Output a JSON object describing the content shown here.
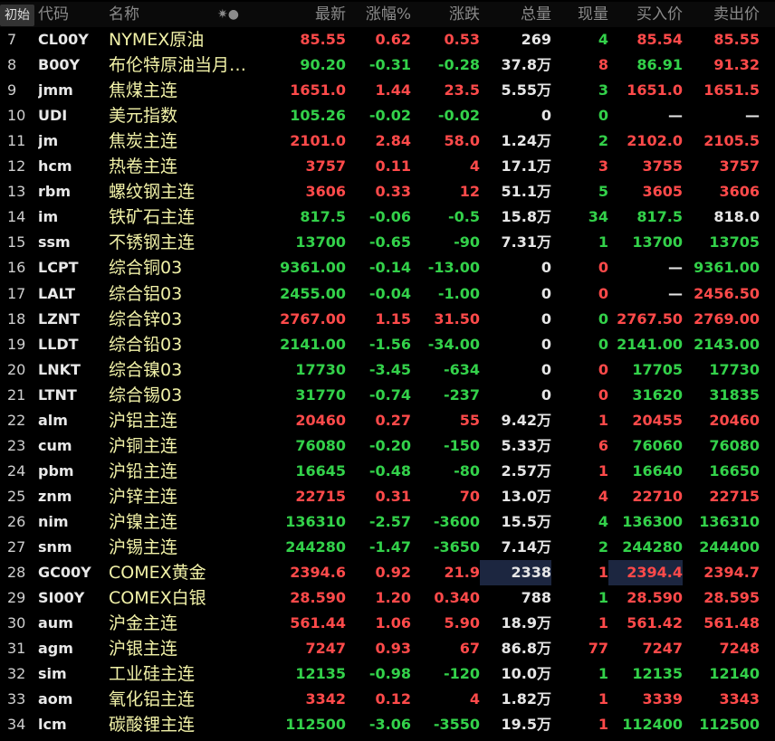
{
  "header": {
    "init": "初始",
    "code": "代码",
    "name": "名称",
    "icons": "✷●",
    "last": "最新",
    "pct": "涨幅%",
    "chg": "涨跌",
    "vol": "总量",
    "cur": "现量",
    "bid": "买入价",
    "ask": "卖出价"
  },
  "colors": {
    "up": "#ff4a4a",
    "down": "#33d14a",
    "name": "#f2f2a8",
    "highlight": "#1c2640"
  },
  "rows": [
    {
      "no": "7",
      "code": "CL00Y",
      "name": "NYMEX原油",
      "last": "85.55",
      "pct": "0.62",
      "chg": "0.53",
      "vol": "269",
      "cur": "4",
      "bid": "85.54",
      "ask": "85.55",
      "d": "up",
      "cd": "dn",
      "bd": "up",
      "ad": "up"
    },
    {
      "no": "8",
      "code": "B00Y",
      "name": "布伦特原油当月…",
      "last": "90.20",
      "pct": "-0.31",
      "chg": "-0.28",
      "vol": "37.8万",
      "cur": "8",
      "bid": "86.91",
      "ask": "91.32",
      "d": "dn",
      "cd": "up",
      "bd": "dn",
      "ad": "up"
    },
    {
      "no": "9",
      "code": "jmm",
      "name": "焦煤主连",
      "last": "1651.0",
      "pct": "1.44",
      "chg": "23.5",
      "vol": "5.55万",
      "cur": "3",
      "bid": "1651.0",
      "ask": "1651.5",
      "d": "up",
      "cd": "dn",
      "bd": "up",
      "ad": "up"
    },
    {
      "no": "10",
      "code": "UDI",
      "name": "美元指数",
      "last": "105.26",
      "pct": "-0.02",
      "chg": "-0.02",
      "vol": "0",
      "cur": "0",
      "bid": "—",
      "ask": "—",
      "d": "dn",
      "cd": "dn",
      "bd": "flat",
      "ad": "flat"
    },
    {
      "no": "11",
      "code": "jm",
      "name": "焦炭主连",
      "last": "2101.0",
      "pct": "2.84",
      "chg": "58.0",
      "vol": "1.24万",
      "cur": "2",
      "bid": "2102.0",
      "ask": "2105.5",
      "d": "up",
      "cd": "dn",
      "bd": "up",
      "ad": "up"
    },
    {
      "no": "12",
      "code": "hcm",
      "name": "热卷主连",
      "last": "3757",
      "pct": "0.11",
      "chg": "4",
      "vol": "17.1万",
      "cur": "3",
      "bid": "3755",
      "ask": "3757",
      "d": "up",
      "cd": "up",
      "bd": "up",
      "ad": "up"
    },
    {
      "no": "13",
      "code": "rbm",
      "name": "螺纹钢主连",
      "last": "3606",
      "pct": "0.33",
      "chg": "12",
      "vol": "51.1万",
      "cur": "5",
      "bid": "3605",
      "ask": "3606",
      "d": "up",
      "cd": "dn",
      "bd": "up",
      "ad": "up"
    },
    {
      "no": "14",
      "code": "im",
      "name": "铁矿石主连",
      "last": "817.5",
      "pct": "-0.06",
      "chg": "-0.5",
      "vol": "15.8万",
      "cur": "34",
      "bid": "817.5",
      "ask": "818.0",
      "d": "dn",
      "cd": "dn",
      "bd": "dn",
      "ad": "flat"
    },
    {
      "no": "15",
      "code": "ssm",
      "name": "不锈钢主连",
      "last": "13700",
      "pct": "-0.65",
      "chg": "-90",
      "vol": "7.31万",
      "cur": "1",
      "bid": "13700",
      "ask": "13705",
      "d": "dn",
      "cd": "dn",
      "bd": "dn",
      "ad": "dn"
    },
    {
      "no": "16",
      "code": "LCPT",
      "name": "综合铜03",
      "last": "9361.00",
      "pct": "-0.14",
      "chg": "-13.00",
      "vol": "0",
      "cur": "0",
      "bid": "—",
      "ask": "9361.00",
      "d": "dn",
      "cd": "up",
      "bd": "flat",
      "ad": "dn"
    },
    {
      "no": "17",
      "code": "LALT",
      "name": "综合铝03",
      "last": "2455.00",
      "pct": "-0.04",
      "chg": "-1.00",
      "vol": "0",
      "cur": "0",
      "bid": "—",
      "ask": "2456.50",
      "d": "dn",
      "cd": "up",
      "bd": "flat",
      "ad": "up"
    },
    {
      "no": "18",
      "code": "LZNT",
      "name": "综合锌03",
      "last": "2767.00",
      "pct": "1.15",
      "chg": "31.50",
      "vol": "0",
      "cur": "0",
      "bid": "2767.50",
      "ask": "2769.00",
      "d": "up",
      "cd": "dn",
      "bd": "up",
      "ad": "up"
    },
    {
      "no": "19",
      "code": "LLDT",
      "name": "综合铅03",
      "last": "2141.00",
      "pct": "-1.56",
      "chg": "-34.00",
      "vol": "0",
      "cur": "0",
      "bid": "2141.00",
      "ask": "2143.00",
      "d": "dn",
      "cd": "dn",
      "bd": "dn",
      "ad": "dn"
    },
    {
      "no": "20",
      "code": "LNKT",
      "name": "综合镍03",
      "last": "17730",
      "pct": "-3.45",
      "chg": "-634",
      "vol": "0",
      "cur": "0",
      "bid": "17705",
      "ask": "17730",
      "d": "dn",
      "cd": "up",
      "bd": "dn",
      "ad": "dn"
    },
    {
      "no": "21",
      "code": "LTNT",
      "name": "综合锡03",
      "last": "31770",
      "pct": "-0.74",
      "chg": "-237",
      "vol": "0",
      "cur": "0",
      "bid": "31620",
      "ask": "31835",
      "d": "dn",
      "cd": "up",
      "bd": "dn",
      "ad": "dn"
    },
    {
      "no": "22",
      "code": "alm",
      "name": "沪铝主连",
      "last": "20460",
      "pct": "0.27",
      "chg": "55",
      "vol": "9.42万",
      "cur": "1",
      "bid": "20455",
      "ask": "20460",
      "d": "up",
      "cd": "up",
      "bd": "up",
      "ad": "up"
    },
    {
      "no": "23",
      "code": "cum",
      "name": "沪铜主连",
      "last": "76080",
      "pct": "-0.20",
      "chg": "-150",
      "vol": "5.33万",
      "cur": "6",
      "bid": "76060",
      "ask": "76080",
      "d": "dn",
      "cd": "up",
      "bd": "dn",
      "ad": "dn"
    },
    {
      "no": "24",
      "code": "pbm",
      "name": "沪铅主连",
      "last": "16645",
      "pct": "-0.48",
      "chg": "-80",
      "vol": "2.57万",
      "cur": "1",
      "bid": "16640",
      "ask": "16650",
      "d": "dn",
      "cd": "up",
      "bd": "dn",
      "ad": "dn"
    },
    {
      "no": "25",
      "code": "znm",
      "name": "沪锌主连",
      "last": "22715",
      "pct": "0.31",
      "chg": "70",
      "vol": "13.0万",
      "cur": "4",
      "bid": "22710",
      "ask": "22715",
      "d": "up",
      "cd": "up",
      "bd": "up",
      "ad": "up"
    },
    {
      "no": "26",
      "code": "nim",
      "name": "沪镍主连",
      "last": "136310",
      "pct": "-2.57",
      "chg": "-3600",
      "vol": "15.5万",
      "cur": "4",
      "bid": "136300",
      "ask": "136310",
      "d": "dn",
      "cd": "dn",
      "bd": "dn",
      "ad": "dn"
    },
    {
      "no": "27",
      "code": "snm",
      "name": "沪锡主连",
      "last": "244280",
      "pct": "-1.47",
      "chg": "-3650",
      "vol": "7.14万",
      "cur": "2",
      "bid": "244280",
      "ask": "244400",
      "d": "dn",
      "cd": "dn",
      "bd": "dn",
      "ad": "dn"
    },
    {
      "no": "28",
      "code": "GC00Y",
      "name": "COMEX黄金",
      "last": "2394.6",
      "pct": "0.92",
      "chg": "21.9",
      "vol": "2338",
      "cur": "1",
      "bid": "2394.4",
      "ask": "2394.7",
      "d": "up",
      "cd": "up",
      "bd": "up",
      "ad": "up",
      "hl": true
    },
    {
      "no": "29",
      "code": "SI00Y",
      "name": "COMEX白银",
      "last": "28.590",
      "pct": "1.20",
      "chg": "0.340",
      "vol": "788",
      "cur": "1",
      "bid": "28.590",
      "ask": "28.595",
      "d": "up",
      "cd": "dn",
      "bd": "up",
      "ad": "up"
    },
    {
      "no": "30",
      "code": "aum",
      "name": "沪金主连",
      "last": "561.44",
      "pct": "1.06",
      "chg": "5.90",
      "vol": "18.9万",
      "cur": "1",
      "bid": "561.42",
      "ask": "561.48",
      "d": "up",
      "cd": "up",
      "bd": "up",
      "ad": "up"
    },
    {
      "no": "31",
      "code": "agm",
      "name": "沪银主连",
      "last": "7247",
      "pct": "0.93",
      "chg": "67",
      "vol": "86.8万",
      "cur": "77",
      "bid": "7247",
      "ask": "7248",
      "d": "up",
      "cd": "up",
      "bd": "up",
      "ad": "up"
    },
    {
      "no": "32",
      "code": "sim",
      "name": "工业硅主连",
      "last": "12135",
      "pct": "-0.98",
      "chg": "-120",
      "vol": "10.0万",
      "cur": "1",
      "bid": "12135",
      "ask": "12140",
      "d": "dn",
      "cd": "dn",
      "bd": "dn",
      "ad": "dn"
    },
    {
      "no": "33",
      "code": "aom",
      "name": "氧化铝主连",
      "last": "3342",
      "pct": "0.12",
      "chg": "4",
      "vol": "1.82万",
      "cur": "1",
      "bid": "3339",
      "ask": "3343",
      "d": "up",
      "cd": "up",
      "bd": "up",
      "ad": "up"
    },
    {
      "no": "34",
      "code": "lcm",
      "name": "碳酸锂主连",
      "last": "112500",
      "pct": "-3.06",
      "chg": "-3550",
      "vol": "19.5万",
      "cur": "1",
      "bid": "112400",
      "ask": "112500",
      "d": "dn",
      "cd": "up",
      "bd": "dn",
      "ad": "dn"
    }
  ]
}
